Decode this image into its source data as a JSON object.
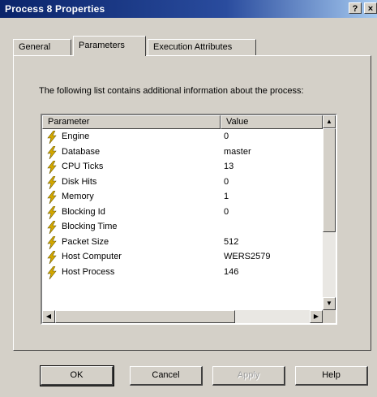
{
  "window": {
    "title": "Process 8 Properties",
    "help_glyph": "?",
    "close_glyph": "×"
  },
  "tabs": [
    {
      "label": "General"
    },
    {
      "label": "Parameters",
      "active": true
    },
    {
      "label": "Execution Attributes"
    }
  ],
  "description": "The following list contains additional information about the process:",
  "list": {
    "columns": [
      "Parameter",
      "Value"
    ],
    "rows": [
      {
        "parameter": "Engine",
        "value": "0"
      },
      {
        "parameter": "Database",
        "value": "master"
      },
      {
        "parameter": "CPU Ticks",
        "value": "13"
      },
      {
        "parameter": "Disk Hits",
        "value": "0"
      },
      {
        "parameter": "Memory",
        "value": "1"
      },
      {
        "parameter": "Blocking Id",
        "value": "0"
      },
      {
        "parameter": "Blocking Time",
        "value": ""
      },
      {
        "parameter": "Packet Size",
        "value": "512"
      },
      {
        "parameter": "Host Computer",
        "value": "WERS2579"
      },
      {
        "parameter": "Host Process",
        "value": "146"
      }
    ],
    "row_icon": "lightning-bolt-icon"
  },
  "buttons": {
    "ok": "OK",
    "cancel": "Cancel",
    "apply": "Apply",
    "help": "Help"
  },
  "colors": {
    "title_bar": "#0a246a",
    "face": "#d4d0c8",
    "bolt": "#d4a800"
  }
}
